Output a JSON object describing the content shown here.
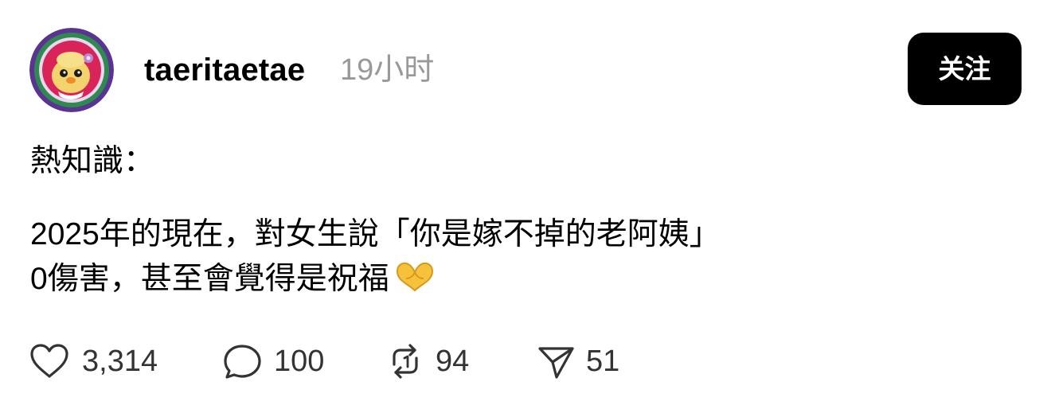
{
  "post": {
    "username": "taeritaetae",
    "timestamp": "19小时",
    "follow_label": "关注",
    "lines": [
      "熱知識：",
      "2025年的現在，對女生說「你是嫁不掉的老阿姨」",
      "0傷害，甚至會覺得是祝福"
    ],
    "emoji_icon": "heart-hands-icon"
  },
  "actions": {
    "like_count": "3,314",
    "comment_count": "100",
    "repost_count": "94",
    "share_count": "51"
  },
  "colors": {
    "text": "#000000",
    "muted": "#999999",
    "button_bg": "#000000",
    "button_text": "#ffffff",
    "avatar_ring": "#6f3fa6",
    "avatar_bg": "#d9245a"
  }
}
